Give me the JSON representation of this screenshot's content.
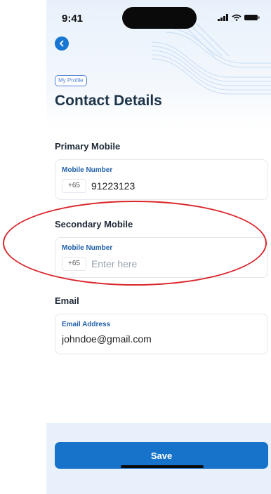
{
  "status_bar": {
    "time": "9:41",
    "icons": [
      "signal-icon",
      "wifi-icon",
      "battery-icon"
    ]
  },
  "header": {
    "back_icon": "back-arrow-icon",
    "breadcrumb": "My Profile",
    "title": "Contact Details"
  },
  "primary": {
    "section_label": "Primary Mobile",
    "field_label": "Mobile Number",
    "country_code": "+65",
    "value": "91223123"
  },
  "secondary": {
    "section_label": "Secondary Mobile",
    "field_label": "Mobile Number",
    "country_code": "+65",
    "placeholder": "Enter here"
  },
  "email": {
    "section_label": "Email",
    "field_label": "Email Address",
    "value": "johndoe@gmail.com"
  },
  "footer": {
    "save_label": "Save"
  },
  "colors": {
    "accent": "#1673c9",
    "annotation": "#d9252b",
    "label": "#1f5fa8"
  }
}
